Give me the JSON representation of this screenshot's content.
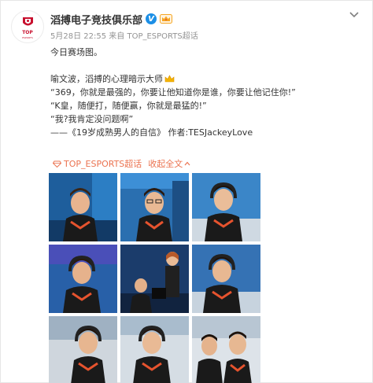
{
  "account": {
    "name": "滔搏电子竞技俱乐部",
    "logo_text": "TOP",
    "logo_sub": "ESPORTS",
    "verified_mark": "V"
  },
  "meta": {
    "date": "5月28日 22:55",
    "source_prefix": "来自",
    "source": "TOP_ESPORTS超话"
  },
  "content": {
    "line1": "今日赛场图。",
    "line2": "喻文波，滔搏的心理暗示大师",
    "line3": "“369，你就是最强的，你要让他知道你是谁，你要让他记住你!”",
    "line4": "“K皇，随便打，随便赢，你就是最猛的!”",
    "line5": "“我?我肯定没问题啊”",
    "line6": "——《19岁成熟男人的自信》 作者:TESJackeyLove"
  },
  "tags": {
    "topic": "TOP_ESPORTS超话",
    "expand": "收起全文"
  },
  "colors": {
    "accent": "#eb7350",
    "verified": "#1c8fe6",
    "brand_red": "#c8102e"
  },
  "photos": [
    {
      "name": "photo-1"
    },
    {
      "name": "photo-2"
    },
    {
      "name": "photo-3"
    },
    {
      "name": "photo-4"
    },
    {
      "name": "photo-5"
    },
    {
      "name": "photo-6"
    },
    {
      "name": "photo-7"
    },
    {
      "name": "photo-8"
    },
    {
      "name": "photo-9"
    }
  ]
}
